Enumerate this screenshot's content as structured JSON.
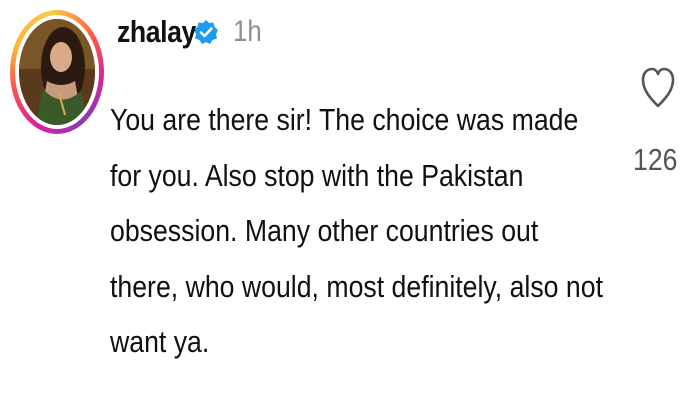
{
  "comment": {
    "username": "zhalay",
    "verified_icon": "verified-badge-icon",
    "time": "1h",
    "lines": [
      "You are there sir! The choice was made",
      "for you. Also stop with the Pakistan",
      "obsession. Many other countries out",
      "there, who would, most definitely, also not",
      "want ya."
    ],
    "like_icon": "heart-outline-icon",
    "like_count": "126"
  },
  "colors": {
    "verified_blue": "#1d9bf0",
    "timestamp_gray": "#8e8e8e",
    "text": "#111111"
  }
}
